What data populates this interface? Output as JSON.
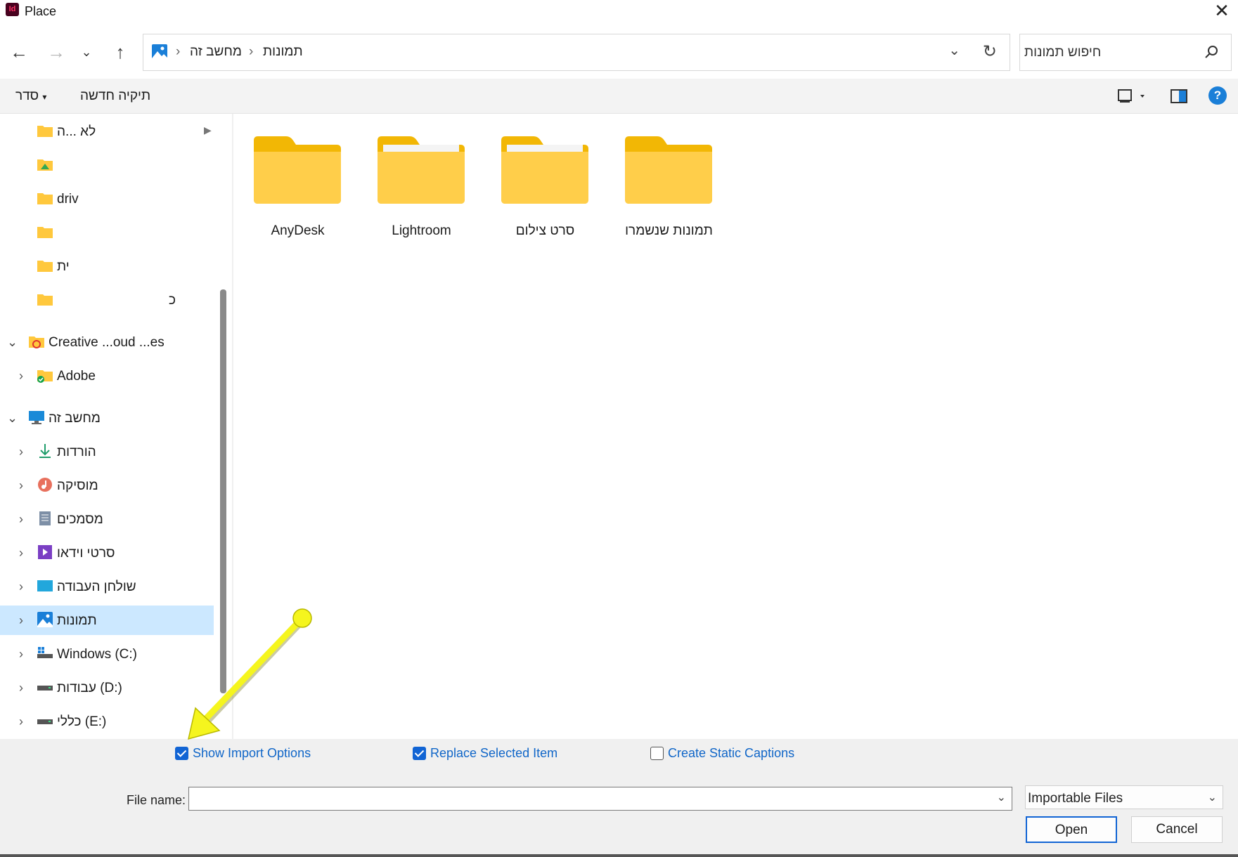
{
  "window": {
    "app_icon_text": "Id",
    "title": "Place",
    "close_glyph": "✕"
  },
  "nav": {
    "back": "←",
    "forward": "→",
    "recent": "⌄",
    "up": "↑"
  },
  "address": {
    "breadcrumbs": [
      "מחשב זה",
      "תמונות"
    ],
    "separator": "›",
    "dropdown_glyph": "⌄",
    "refresh_glyph": "↻"
  },
  "search": {
    "placeholder": "חיפוש תמונות"
  },
  "commands": {
    "sort": "סדר",
    "new_folder": "תיקיה חדשה",
    "help": "?"
  },
  "sidebar": {
    "items": [
      {
        "label": "לא ...ה",
        "icon": "folder-icon",
        "expandable": true,
        "state": "partial"
      },
      {
        "label": "",
        "icon": "drive-folder-icon",
        "expandable": false
      },
      {
        "label": "driv",
        "icon": "folder-icon",
        "expandable": false
      },
      {
        "label": "",
        "icon": "folder-icon",
        "expandable": false
      },
      {
        "label": "ית",
        "icon": "folder-icon",
        "expandable": false
      },
      {
        "label": "כ",
        "icon": "folder-icon",
        "expandable": false
      },
      {
        "label": "Creative ...oud ...es",
        "icon": "creative-cloud-icon",
        "expandable": true,
        "expanded": true
      },
      {
        "label": "Adobe",
        "icon": "synced-folder-icon",
        "expandable": true
      },
      {
        "label": "מחשב זה",
        "icon": "computer-icon",
        "expandable": true,
        "expanded": true
      },
      {
        "label": "הורדות",
        "icon": "downloads-icon",
        "expandable": true
      },
      {
        "label": "מוסיקה",
        "icon": "music-icon",
        "expandable": true
      },
      {
        "label": "מסמכים",
        "icon": "documents-icon",
        "expandable": true
      },
      {
        "label": "סרטי וידאו",
        "icon": "videos-icon",
        "expandable": true
      },
      {
        "label": "שולחן העבודה",
        "icon": "desktop-icon",
        "expandable": true
      },
      {
        "label": "תמונות",
        "icon": "pictures-icon",
        "expandable": true,
        "selected": true
      },
      {
        "label": "Windows (C:)",
        "icon": "windows-drive-icon",
        "expandable": true
      },
      {
        "label": "עבודות (D:)",
        "icon": "drive-icon",
        "expandable": true
      },
      {
        "label": "כללי (E:)",
        "icon": "drive-icon",
        "expandable": true
      }
    ]
  },
  "content": {
    "folders": [
      {
        "name": "AnyDesk"
      },
      {
        "name": "Lightroom"
      },
      {
        "name": "סרט צילום"
      },
      {
        "name": "תמונות שנשמרו"
      }
    ]
  },
  "options": {
    "show_import_options": {
      "label": "Show Import Options",
      "checked": true
    },
    "replace_selected_item": {
      "label": "Replace Selected Item",
      "checked": true
    },
    "create_static_captions": {
      "label": "Create Static Captions",
      "checked": false
    }
  },
  "footer": {
    "file_name_label": "File name:",
    "file_name_value": "",
    "file_type": "Importable Files",
    "open": "Open",
    "cancel": "Cancel"
  },
  "colors": {
    "accent": "#1164d4",
    "selection": "#cce8ff",
    "folder": "#ffc83d",
    "annotation_arrow": "#f5f51e"
  }
}
